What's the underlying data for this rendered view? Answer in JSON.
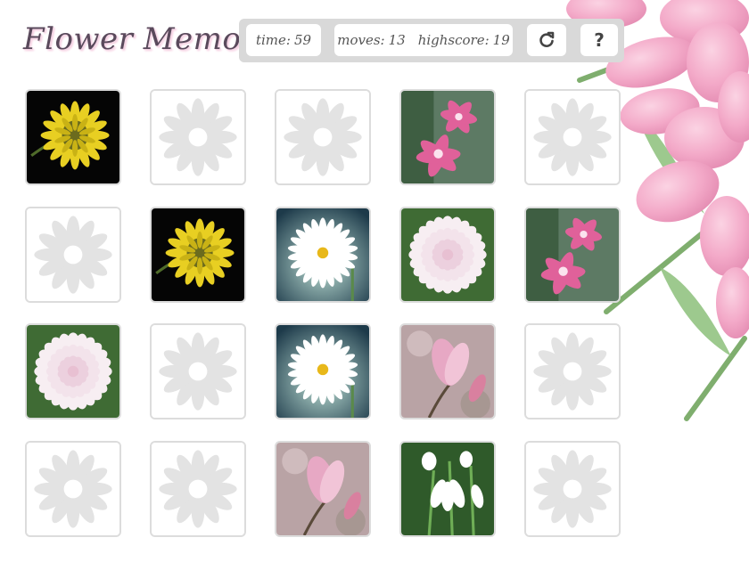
{
  "app": {
    "title": "Flower Memory"
  },
  "hud": {
    "time_label": "time:",
    "time_value": "59",
    "moves_label": "moves:",
    "moves_value": "13",
    "highscore_label": "highscore:",
    "highscore_value": "19",
    "restart_icon": "restart-icon",
    "help_label": "?"
  },
  "colors": {
    "card_border": "#dcdcdc",
    "card_back_petal": "#e3e3e3",
    "hud_bg": "#d9d9d9",
    "title": "#5a4a5c"
  },
  "board": {
    "rows": 4,
    "cols": 5,
    "cards": [
      {
        "state": "revealed",
        "flower": "sunflower"
      },
      {
        "state": "hidden",
        "flower": null
      },
      {
        "state": "hidden",
        "flower": null
      },
      {
        "state": "revealed",
        "flower": "lily"
      },
      {
        "state": "hidden",
        "flower": null
      },
      {
        "state": "hidden",
        "flower": null
      },
      {
        "state": "revealed",
        "flower": "sunflower"
      },
      {
        "state": "revealed",
        "flower": "daisy"
      },
      {
        "state": "revealed",
        "flower": "dahlia"
      },
      {
        "state": "revealed",
        "flower": "lily"
      },
      {
        "state": "revealed",
        "flower": "dahlia"
      },
      {
        "state": "hidden",
        "flower": null
      },
      {
        "state": "revealed",
        "flower": "daisy"
      },
      {
        "state": "revealed",
        "flower": "magnolia"
      },
      {
        "state": "hidden",
        "flower": null
      },
      {
        "state": "hidden",
        "flower": null
      },
      {
        "state": "hidden",
        "flower": null
      },
      {
        "state": "revealed",
        "flower": "magnolia"
      },
      {
        "state": "revealed",
        "flower": "snowdrop"
      },
      {
        "state": "hidden",
        "flower": null
      }
    ]
  }
}
